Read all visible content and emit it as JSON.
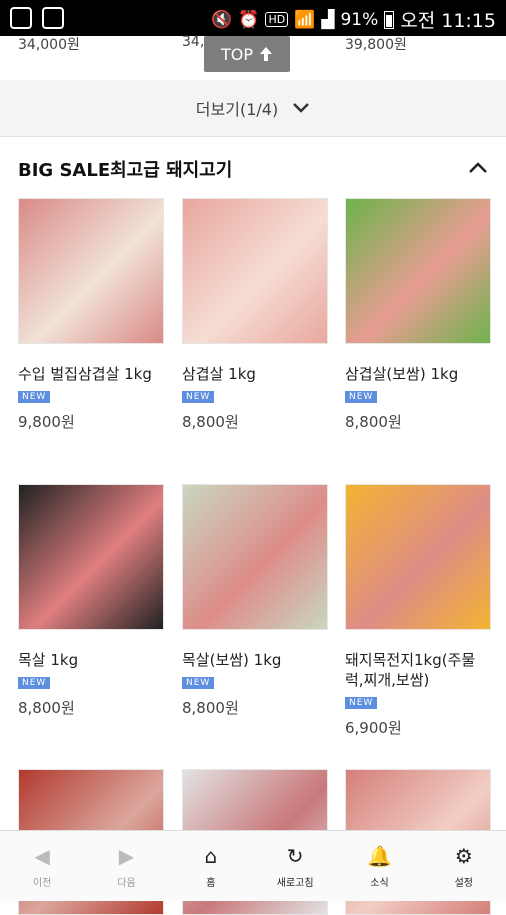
{
  "status_bar": {
    "battery": "91%",
    "time": "오전 11:15"
  },
  "top_prices": [
    "34,000원",
    "34,...",
    "39,800원"
  ],
  "top_button": {
    "label": "TOP"
  },
  "more": {
    "label": "더보기(1/4)"
  },
  "section": {
    "title": "BIG SALE최고급 돼지고기"
  },
  "badge_text": "NEW",
  "products": [
    {
      "name": "수입 벌집삼겹살 1kg",
      "price": "9,800원",
      "colors": [
        "#d98a86",
        "#f1e2d8"
      ]
    },
    {
      "name": "삼겹살 1kg",
      "price": "8,800원",
      "colors": [
        "#e8a79e",
        "#f6ddd4"
      ]
    },
    {
      "name": "삼겹살(보쌈) 1kg",
      "price": "8,800원",
      "colors": [
        "#6db34c",
        "#e79d92"
      ]
    },
    {
      "name": "목살 1kg",
      "price": "8,800원",
      "colors": [
        "#222222",
        "#e07e7f"
      ]
    },
    {
      "name": "목살(보쌈) 1kg",
      "price": "8,800원",
      "colors": [
        "#c9d7c0",
        "#de8c89"
      ]
    },
    {
      "name": "돼지목전지1kg(주물럭,찌개,보쌈)",
      "price": "6,900원",
      "colors": [
        "#f2b432",
        "#de8c86"
      ]
    },
    {
      "name": "",
      "price": "",
      "colors": [
        "#b23a2f",
        "#dba69c"
      ]
    },
    {
      "name": "",
      "price": "",
      "colors": [
        "#e2e2e2",
        "#c9787a"
      ]
    },
    {
      "name": "",
      "price": "",
      "colors": [
        "#d57f7a",
        "#f1cdc4"
      ]
    }
  ],
  "bottom_nav": [
    {
      "label": "이전",
      "icon": "back-icon",
      "glyph": "◀"
    },
    {
      "label": "다음",
      "icon": "forward-icon",
      "glyph": "▶"
    },
    {
      "label": "홈",
      "icon": "home-icon",
      "glyph": "⌂"
    },
    {
      "label": "새로고침",
      "icon": "refresh-icon",
      "glyph": "↻"
    },
    {
      "label": "소식",
      "icon": "bell-icon",
      "glyph": "🔔"
    },
    {
      "label": "설정",
      "icon": "gear-icon",
      "glyph": "⚙"
    }
  ]
}
